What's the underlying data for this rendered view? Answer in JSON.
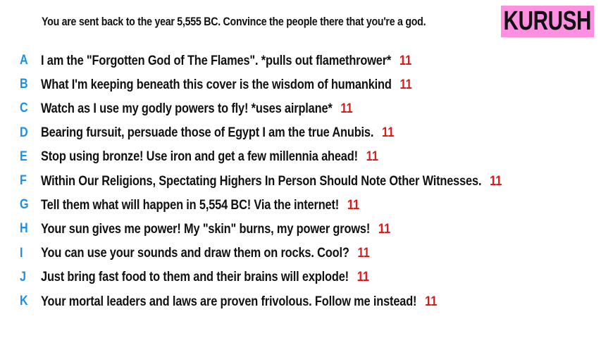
{
  "prompt": "You are sent back to the year 5,555 BC. Convince the people there that you're a god.",
  "player": {
    "name": "KURUSH",
    "badge_color": "#ff8fe0"
  },
  "colors": {
    "letter": "#1e8fe6",
    "score": "#e01818",
    "text": "#111111"
  },
  "answers": [
    {
      "letter": "A",
      "text": "I am the \"Forgotten God of The Flames\". *pulls out flamethrower*",
      "score": "11"
    },
    {
      "letter": "B",
      "text": "What I'm keeping beneath this cover is the wisdom of humankind",
      "score": "11"
    },
    {
      "letter": "C",
      "text": "Watch as I use my godly powers to fly!  *uses airplane*",
      "score": "11"
    },
    {
      "letter": "D",
      "text": "Bearing fursuit, persuade those of Egypt I am the true Anubis.",
      "score": "11"
    },
    {
      "letter": "E",
      "text": "Stop using bronze! Use iron and get a few millennia ahead!",
      "score": "11"
    },
    {
      "letter": "F",
      "text": "Within Our Religions, Spectating Highers In Person Should Note Other Witnesses.",
      "score": "11"
    },
    {
      "letter": "G",
      "text": "Tell them what will happen in 5,554 BC! Via the internet!",
      "score": "11"
    },
    {
      "letter": "H",
      "text": "Your sun gives me power! My \"skin\" burns, my power grows!",
      "score": "11"
    },
    {
      "letter": "I",
      "text": "You can use your sounds and draw them on rocks. Cool?",
      "score": "11"
    },
    {
      "letter": "J",
      "text": "Just bring fast food to them and their brains will explode!",
      "score": "11"
    },
    {
      "letter": "K",
      "text": "Your mortal leaders and laws are proven frivolous. Follow me instead!",
      "score": "11"
    }
  ]
}
